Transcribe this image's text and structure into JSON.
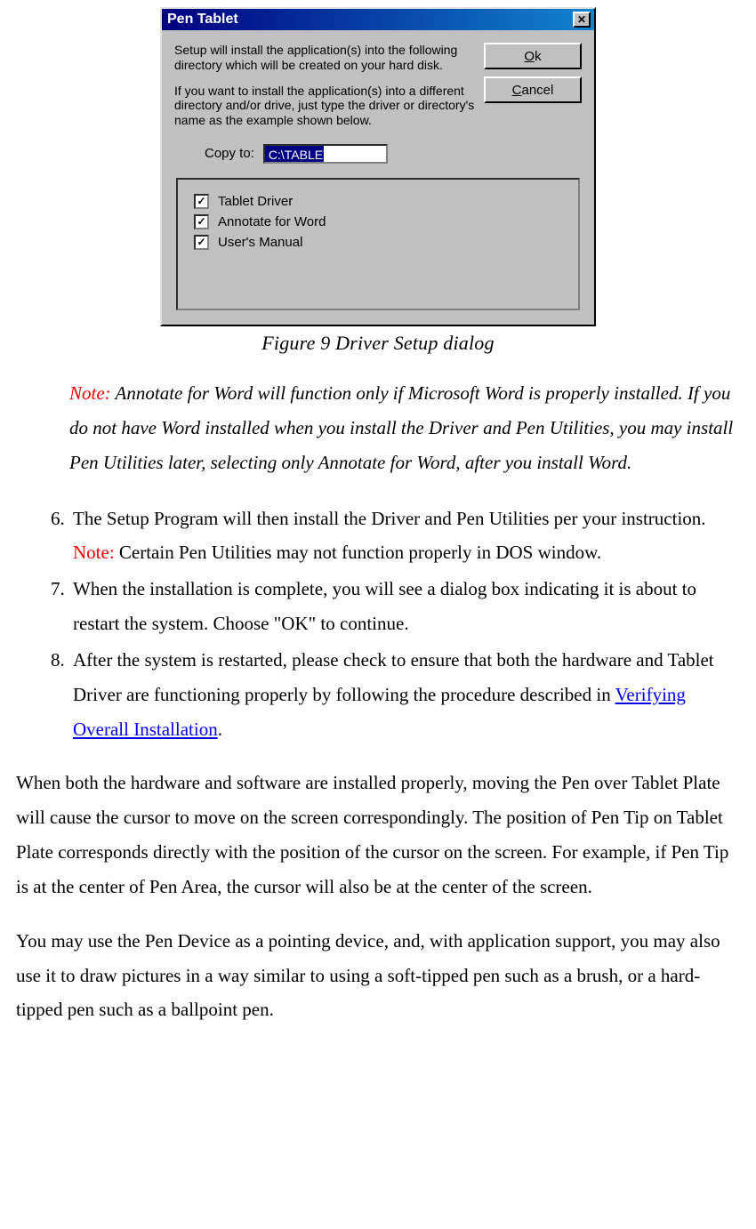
{
  "dialog": {
    "title": "Pen Tablet",
    "text1": "Setup will install the application(s) into the following directory which will be created on your hard disk.",
    "text2": "If you want to install the application(s) into a different directory and/or drive, just type the driver or directory's name as the example shown below.",
    "copy_label": "Copy to:",
    "copy_value": "C:\\TABLET",
    "ok_label_pre": "O",
    "ok_label_rest": "k",
    "cancel_label_pre": "C",
    "cancel_label_rest": "ancel",
    "options": [
      {
        "label": "Tablet Driver",
        "checked": true
      },
      {
        "label": "Annotate for Word",
        "checked": true
      },
      {
        "label": "User's Manual",
        "checked": true
      }
    ],
    "close_glyph": "✕"
  },
  "caption": "Figure 9 Driver Setup dialog",
  "note": {
    "label": "Note:",
    "text": " Annotate for Word will function only if Microsoft Word is properly installed.   If you do not have Word installed when you install the Driver and Pen Utilities, you may install Pen Utilities later, selecting only Annotate for Word, after you install Word."
  },
  "steps": {
    "start": 6,
    "items": {
      "s6_pre": "The Setup Program will then install the Driver and Pen Utilities per your instruction. ",
      "s6_note_label": "Note:",
      "s6_post": " Certain Pen Utilities may not function properly in DOS window.",
      "s7": "When the installation is complete, you will see a dialog box indicating it is about to restart the system.   Choose \"OK\" to continue.",
      "s8_pre": "After the system is restarted, please check to ensure that both the hardware and Tablet Driver are functioning properly by following the procedure described in ",
      "s8_link": "Verifying Overall Installation",
      "s8_post": "."
    }
  },
  "para1": "When both the hardware and software are installed properly, moving the Pen over Tablet Plate will cause the cursor to move on the screen correspondingly.   The position of Pen Tip on Tablet Plate corresponds directly with the position of the cursor on the screen.   For example, if Pen Tip is at the center of Pen Area, the cursor will also be at the center of the screen.",
  "para2": "You may use the Pen Device as a pointing device, and, with application support, you may also use it to draw pictures in a way similar to using a soft-tipped pen such as a brush, or a hard-tipped pen such as a ballpoint pen."
}
